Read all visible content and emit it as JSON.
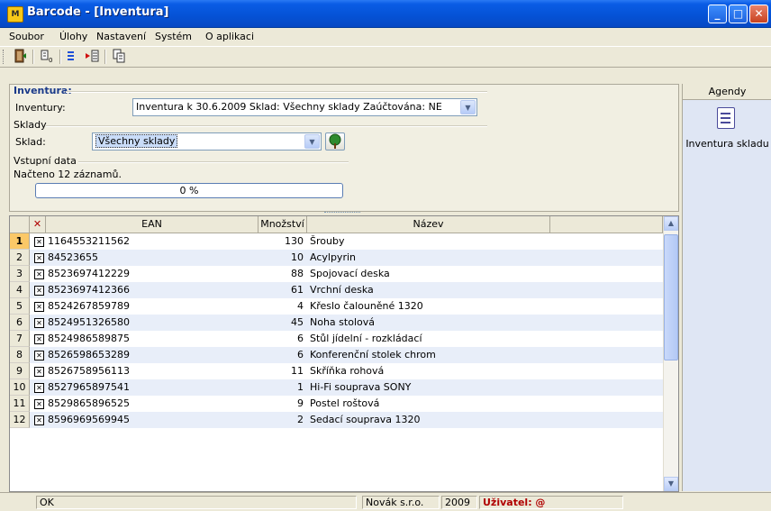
{
  "window": {
    "title": "Barcode - [Inventura]",
    "icon_text": "M",
    "minimize_glyph": "_",
    "maximize_glyph": "□",
    "close_glyph": "✕"
  },
  "menu": [
    {
      "label": "Soubor"
    },
    {
      "label": "Úlohy"
    },
    {
      "label": "Nastavení"
    },
    {
      "label": "Systém"
    },
    {
      "label": "O aplikaci"
    }
  ],
  "toolbar": {
    "icons": [
      "exit-door-icon",
      "counter-icon",
      "import-arrow-icon",
      "copy-documents-icon"
    ]
  },
  "inventura": {
    "section_title": "Inventura:",
    "label": "Inventury:",
    "value": "Inventura k 30.6.2009  Sklad: Všechny sklady  Zaúčtována: NE"
  },
  "sklady": {
    "section_title": "Sklady",
    "label": "Sklad:",
    "value": "Všechny sklady"
  },
  "vstupni": {
    "section_title": "Vstupní data",
    "loaded_text": "Načteno 12 záznamů.",
    "progress_text": "0 %",
    "progress_value": 0
  },
  "grid": {
    "headers": {
      "check": "✕",
      "ean": "EAN",
      "mnozstvi": "Množství",
      "nazev": "Název"
    },
    "rows": [
      {
        "n": "1",
        "ean": "1164553211562",
        "qty": "130",
        "name": "Šrouby"
      },
      {
        "n": "2",
        "ean": "84523655",
        "qty": "10",
        "name": "Acylpyrin"
      },
      {
        "n": "3",
        "ean": "8523697412229",
        "qty": "88",
        "name": "Spojovací deska"
      },
      {
        "n": "4",
        "ean": "8523697412366",
        "qty": "61",
        "name": "Vrchní deska"
      },
      {
        "n": "5",
        "ean": "8524267859789",
        "qty": "4",
        "name": "Křeslo čalouněné 1320"
      },
      {
        "n": "6",
        "ean": "8524951326580",
        "qty": "45",
        "name": "Noha stolová"
      },
      {
        "n": "7",
        "ean": "8524986589875",
        "qty": "6",
        "name": "Stůl jídelní - rozkládací"
      },
      {
        "n": "8",
        "ean": "8526598653289",
        "qty": "6",
        "name": "Konferenční stolek chrom"
      },
      {
        "n": "9",
        "ean": "8526758956113",
        "qty": "11",
        "name": "Skříňka rohová"
      },
      {
        "n": "10",
        "ean": "8527965897541",
        "qty": "1",
        "name": "Hi-Fi souprava SONY"
      },
      {
        "n": "11",
        "ean": "8529865896525",
        "qty": "9",
        "name": "Postel roštová"
      },
      {
        "n": "12",
        "ean": "8596969569945",
        "qty": "2",
        "name": "Sedací souprava 1320"
      }
    ]
  },
  "agendy": {
    "title": "Agendy",
    "items": [
      {
        "label": "Inventura skladu",
        "icon": "document-icon"
      }
    ]
  },
  "status": {
    "state": "OK",
    "company": "Novák s.r.o.",
    "year": "2009",
    "user": "Uživatel: @"
  },
  "colors": {
    "title_bar": "#0553d7",
    "selected_row_header": "#fbc867",
    "alt_row": "#e8eef9",
    "selected_combo": "#c9dcf8",
    "user_text": "#b00000"
  }
}
